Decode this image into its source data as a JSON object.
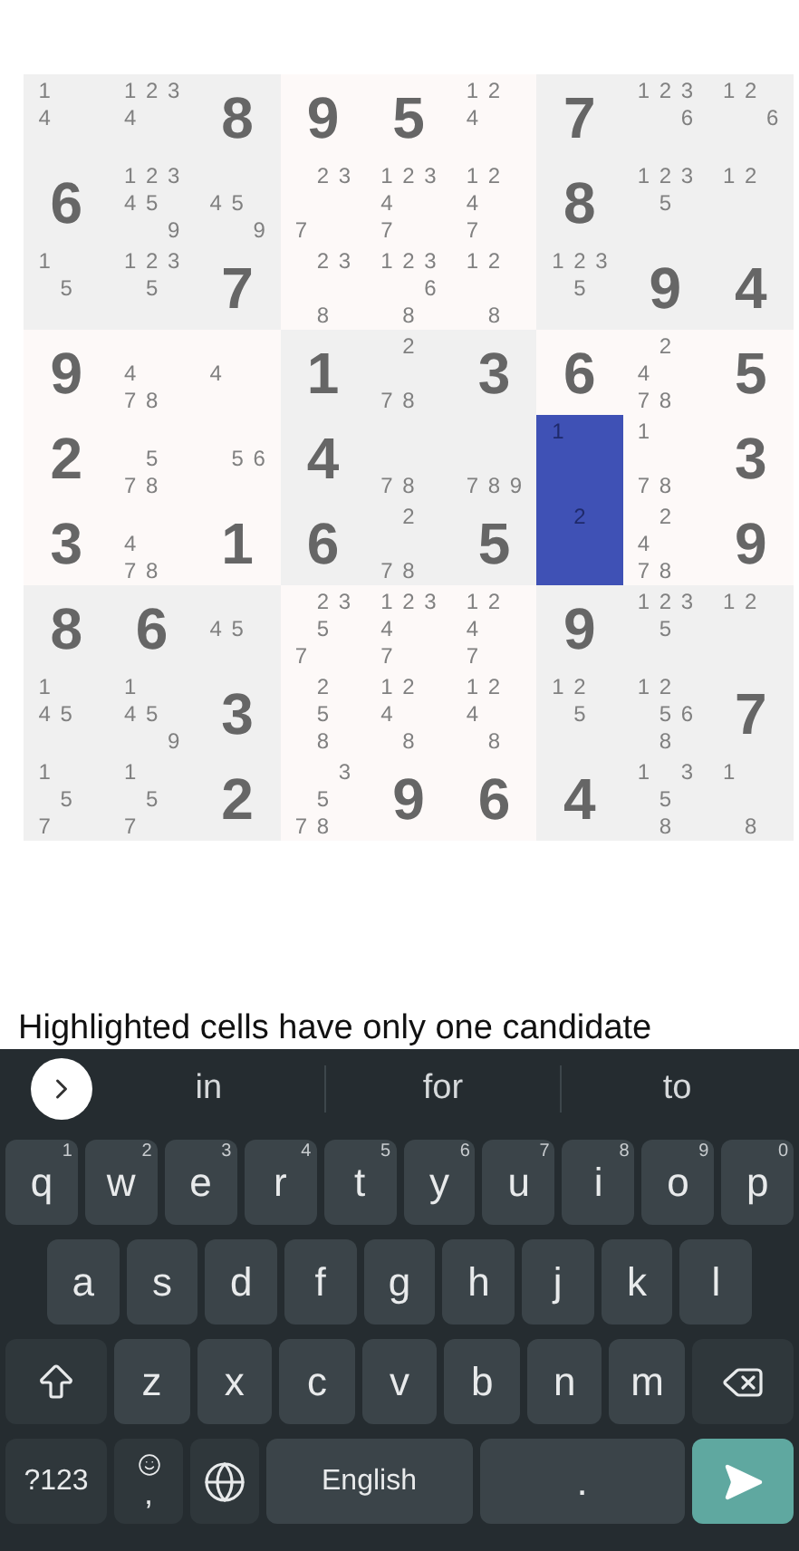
{
  "grid": {
    "rows": [
      [
        {
          "candidates": [
            "1",
            "4"
          ],
          "highlighted": false
        },
        {
          "candidates": [
            "1",
            "2",
            "3",
            "4"
          ],
          "highlighted": false
        },
        {
          "value": "8",
          "highlighted": false
        },
        {
          "value": "9",
          "highlighted": false
        },
        {
          "value": "5",
          "highlighted": false
        },
        {
          "candidates": [
            "1",
            "2",
            "4"
          ],
          "highlighted": false
        },
        {
          "value": "7",
          "highlighted": false
        },
        {
          "candidates": [
            "1",
            "2",
            "3",
            "6"
          ],
          "highlighted": false
        },
        {
          "candidates": [
            "1",
            "2",
            "6"
          ],
          "highlighted": false
        }
      ],
      [
        {
          "value": "6",
          "highlighted": false
        },
        {
          "candidates": [
            "1",
            "2",
            "3",
            "4",
            "5",
            "9"
          ],
          "highlighted": false
        },
        {
          "candidates": [
            "4",
            "5",
            "9"
          ],
          "highlighted": false
        },
        {
          "candidates": [
            "2",
            "3",
            "7"
          ],
          "highlighted": false
        },
        {
          "candidates": [
            "1",
            "2",
            "3",
            "4",
            "7"
          ],
          "highlighted": false
        },
        {
          "candidates": [
            "1",
            "2",
            "4",
            "7"
          ],
          "highlighted": false
        },
        {
          "value": "8",
          "highlighted": false
        },
        {
          "candidates": [
            "1",
            "2",
            "3",
            "5"
          ],
          "highlighted": false
        },
        {
          "candidates": [
            "1",
            "2"
          ],
          "highlighted": false
        }
      ],
      [
        {
          "candidates": [
            "1",
            "5"
          ],
          "highlighted": false
        },
        {
          "candidates": [
            "1",
            "2",
            "3",
            "5"
          ],
          "highlighted": false
        },
        {
          "value": "7",
          "highlighted": false
        },
        {
          "candidates": [
            "2",
            "3",
            "8"
          ],
          "highlighted": false
        },
        {
          "candidates": [
            "1",
            "2",
            "3",
            "6",
            "8"
          ],
          "highlighted": false
        },
        {
          "candidates": [
            "1",
            "2",
            "8"
          ],
          "highlighted": false
        },
        {
          "candidates": [
            "1",
            "2",
            "3",
            "5"
          ],
          "highlighted": false
        },
        {
          "value": "9",
          "highlighted": false
        },
        {
          "value": "4",
          "highlighted": false
        }
      ],
      [
        {
          "value": "9",
          "highlighted": false
        },
        {
          "candidates": [
            "4",
            "7",
            "8"
          ],
          "highlighted": false
        },
        {
          "candidates": [
            "4"
          ],
          "highlighted": false
        },
        {
          "value": "1",
          "highlighted": false
        },
        {
          "candidates": [
            "2",
            "7",
            "8"
          ],
          "highlighted": false
        },
        {
          "value": "3",
          "highlighted": false
        },
        {
          "value": "6",
          "highlighted": false
        },
        {
          "candidates": [
            "2",
            "4",
            "7",
            "8"
          ],
          "highlighted": false
        },
        {
          "value": "5",
          "highlighted": false
        }
      ],
      [
        {
          "value": "2",
          "highlighted": false
        },
        {
          "candidates": [
            "5",
            "7",
            "8"
          ],
          "highlighted": false
        },
        {
          "candidates": [
            "5",
            "6"
          ],
          "highlighted": false
        },
        {
          "value": "4",
          "highlighted": false
        },
        {
          "candidates": [
            "7",
            "8"
          ],
          "highlighted": false
        },
        {
          "candidates": [
            "7",
            "8",
            "9"
          ],
          "highlighted": false
        },
        {
          "candidates": [
            "1"
          ],
          "highlighted": true
        },
        {
          "candidates": [
            "1",
            "7",
            "8"
          ],
          "highlighted": false
        },
        {
          "value": "3",
          "highlighted": false
        }
      ],
      [
        {
          "value": "3",
          "highlighted": false
        },
        {
          "candidates": [
            "4",
            "7",
            "8"
          ],
          "highlighted": false
        },
        {
          "value": "1",
          "highlighted": false
        },
        {
          "value": "6",
          "highlighted": false
        },
        {
          "candidates": [
            "2",
            "7",
            "8"
          ],
          "highlighted": false
        },
        {
          "value": "5",
          "highlighted": false
        },
        {
          "candidates": [
            "2"
          ],
          "highlighted": true
        },
        {
          "candidates": [
            "2",
            "4",
            "7",
            "8"
          ],
          "highlighted": false
        },
        {
          "value": "9",
          "highlighted": false
        }
      ],
      [
        {
          "value": "8",
          "highlighted": false
        },
        {
          "value": "6",
          "highlighted": false
        },
        {
          "candidates": [
            "4",
            "5"
          ],
          "highlighted": false
        },
        {
          "candidates": [
            "2",
            "3",
            "5",
            "7"
          ],
          "highlighted": false
        },
        {
          "candidates": [
            "1",
            "2",
            "3",
            "4",
            "7"
          ],
          "highlighted": false
        },
        {
          "candidates": [
            "1",
            "2",
            "4",
            "7"
          ],
          "highlighted": false
        },
        {
          "value": "9",
          "highlighted": false
        },
        {
          "candidates": [
            "1",
            "2",
            "3",
            "5"
          ],
          "highlighted": false
        },
        {
          "candidates": [
            "1",
            "2"
          ],
          "highlighted": false
        }
      ],
      [
        {
          "candidates": [
            "1",
            "4",
            "5"
          ],
          "highlighted": false
        },
        {
          "candidates": [
            "1",
            "4",
            "5",
            "9"
          ],
          "highlighted": false
        },
        {
          "value": "3",
          "highlighted": false
        },
        {
          "candidates": [
            "2",
            "5",
            "8"
          ],
          "highlighted": false
        },
        {
          "candidates": [
            "1",
            "2",
            "4",
            "8"
          ],
          "highlighted": false
        },
        {
          "candidates": [
            "1",
            "2",
            "4",
            "8"
          ],
          "highlighted": false
        },
        {
          "candidates": [
            "1",
            "2",
            "5"
          ],
          "highlighted": false
        },
        {
          "candidates": [
            "1",
            "2",
            "5",
            "6",
            "8"
          ],
          "highlighted": false
        },
        {
          "value": "7",
          "highlighted": false
        }
      ],
      [
        {
          "candidates": [
            "1",
            "5",
            "7"
          ],
          "highlighted": false
        },
        {
          "candidates": [
            "1",
            "5",
            "7"
          ],
          "highlighted": false
        },
        {
          "value": "2",
          "highlighted": false
        },
        {
          "candidates": [
            "3",
            "5",
            "7",
            "8"
          ],
          "highlighted": false
        },
        {
          "value": "9",
          "highlighted": false
        },
        {
          "value": "6",
          "highlighted": false
        },
        {
          "value": "4",
          "highlighted": false
        },
        {
          "candidates": [
            "1",
            "3",
            "5",
            "8"
          ],
          "highlighted": false
        },
        {
          "candidates": [
            "1",
            "8"
          ],
          "highlighted": false
        }
      ]
    ]
  },
  "message": "Highlighted cells have only one candidate",
  "keyboard": {
    "suggestions": [
      "in",
      "for",
      "to"
    ],
    "rows": [
      [
        {
          "kind": "letter",
          "label": "q",
          "hint": "1"
        },
        {
          "kind": "letter",
          "label": "w",
          "hint": "2"
        },
        {
          "kind": "letter",
          "label": "e",
          "hint": "3"
        },
        {
          "kind": "letter",
          "label": "r",
          "hint": "4"
        },
        {
          "kind": "letter",
          "label": "t",
          "hint": "5"
        },
        {
          "kind": "letter",
          "label": "y",
          "hint": "6"
        },
        {
          "kind": "letter",
          "label": "u",
          "hint": "7"
        },
        {
          "kind": "letter",
          "label": "i",
          "hint": "8"
        },
        {
          "kind": "letter",
          "label": "o",
          "hint": "9"
        },
        {
          "kind": "letter",
          "label": "p",
          "hint": "0"
        }
      ],
      [
        {
          "kind": "letter",
          "label": "a"
        },
        {
          "kind": "letter",
          "label": "s"
        },
        {
          "kind": "letter",
          "label": "d"
        },
        {
          "kind": "letter",
          "label": "f"
        },
        {
          "kind": "letter",
          "label": "g"
        },
        {
          "kind": "letter",
          "label": "h"
        },
        {
          "kind": "letter",
          "label": "j"
        },
        {
          "kind": "letter",
          "label": "k"
        },
        {
          "kind": "letter",
          "label": "l"
        }
      ],
      [
        {
          "kind": "shift"
        },
        {
          "kind": "letter",
          "label": "z"
        },
        {
          "kind": "letter",
          "label": "x"
        },
        {
          "kind": "letter",
          "label": "c"
        },
        {
          "kind": "letter",
          "label": "v"
        },
        {
          "kind": "letter",
          "label": "b"
        },
        {
          "kind": "letter",
          "label": "n"
        },
        {
          "kind": "letter",
          "label": "m"
        },
        {
          "kind": "backspace"
        }
      ],
      [
        {
          "kind": "symbols",
          "label": "?123"
        },
        {
          "kind": "emoji",
          "label": ","
        },
        {
          "kind": "globe"
        },
        {
          "kind": "space",
          "label": "English"
        },
        {
          "kind": "letter",
          "label": "."
        },
        {
          "kind": "enter"
        }
      ]
    ]
  }
}
